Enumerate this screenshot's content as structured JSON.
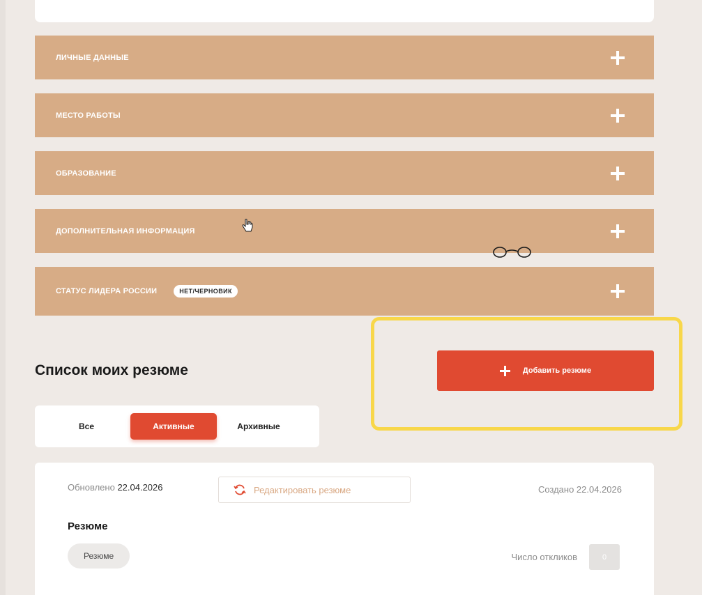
{
  "sections": [
    {
      "label": "ЛИЧНЫЕ ДАННЫЕ"
    },
    {
      "label": "МЕСТО РАБОТЫ"
    },
    {
      "label": "ОБРАЗОВАНИЕ"
    },
    {
      "label": "ДОПОЛНИТЕЛЬНАЯ ИНФОРМАЦИЯ"
    },
    {
      "label": "СТАТУС ЛИДЕРА РОССИИ",
      "badge": "НЕТ/ЧЕРНОВИК"
    }
  ],
  "resume_list": {
    "title": "Список моих резюме",
    "add_button": "Добавить резюме",
    "tabs": [
      {
        "label": "Все"
      },
      {
        "label": "Активные",
        "active": true
      },
      {
        "label": "Архивные"
      }
    ]
  },
  "resume_card": {
    "updated_label": "Обновлено",
    "updated_date": "22.04.2026",
    "edit_button": "Редактировать резюме",
    "created": "Создано 22.04.2026",
    "title": "Резюме",
    "chip": "Резюме",
    "responses_label": "Число откликов",
    "responses_count": "0"
  },
  "icons": {
    "accordion_toggle": "plus-icon",
    "add": "plus-icon",
    "edit": "refresh-icon",
    "pointer": "hand-cursor-icon",
    "glasses": "glasses-icon"
  },
  "colors": {
    "accordion_bg": "#d7ac86",
    "accent": "#e04a31",
    "highlight": "#f8d74a",
    "page_bg": "#efeae6"
  }
}
